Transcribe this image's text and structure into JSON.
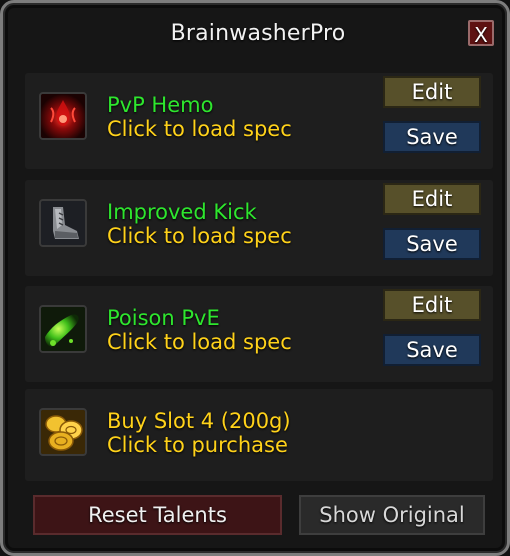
{
  "window": {
    "title": "BrainwasherPro",
    "close_label": "X"
  },
  "specs": [
    {
      "name": "PvP Hemo",
      "subtitle": "Click to load spec",
      "icon": "hemorrhage-icon",
      "edit_label": "Edit",
      "save_label": "Save"
    },
    {
      "name": "Improved Kick",
      "subtitle": "Click to load spec",
      "icon": "kick-boot-icon",
      "edit_label": "Edit",
      "save_label": "Save"
    },
    {
      "name": "Poison PvE",
      "subtitle": "Click to load spec",
      "icon": "poison-icon",
      "edit_label": "Edit",
      "save_label": "Save"
    }
  ],
  "buy_slot": {
    "name": "Buy Slot 4 (200g)",
    "subtitle": "Click to purchase",
    "icon": "gold-coins-icon"
  },
  "footer": {
    "reset_label": "Reset Talents",
    "show_original_label": "Show Original"
  },
  "colors": {
    "spec_name": "#2ee62e",
    "gold_text": "#ffd21a",
    "edit_button": "#57502a",
    "save_button": "#20395a",
    "reset_button": "#3d1416"
  }
}
